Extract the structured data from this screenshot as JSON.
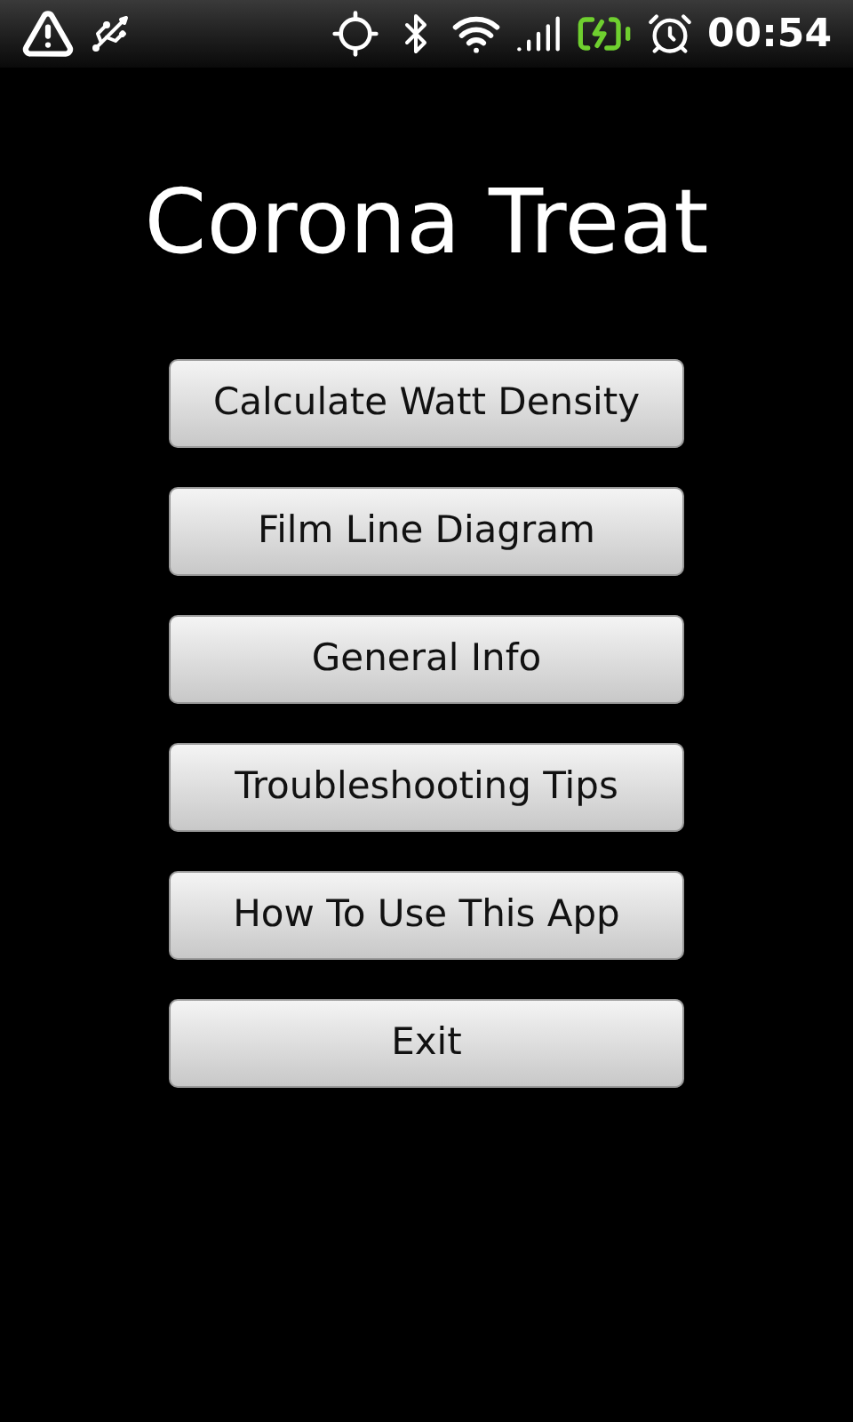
{
  "status_bar": {
    "time": "00:54"
  },
  "title": "Corona Treat",
  "buttons": [
    "Calculate Watt Density",
    "Film Line Diagram",
    "General Info",
    "Troubleshooting Tips",
    "How To Use This App",
    "Exit"
  ]
}
